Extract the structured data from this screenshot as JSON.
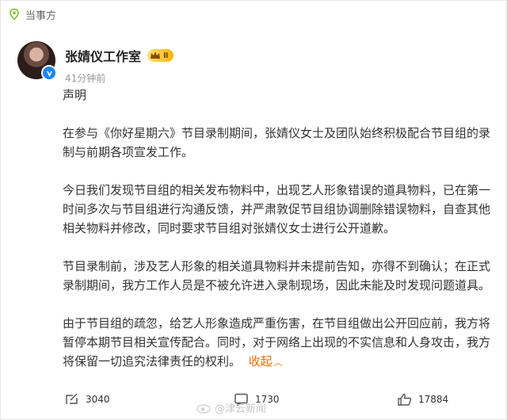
{
  "topbar": {
    "label": "当事方",
    "icon": "location-pin-icon"
  },
  "author": {
    "name": "张婧仪工作室",
    "vip_level": "Ⅱ",
    "time": "41分钟前",
    "verified": true
  },
  "post": {
    "title": "声明",
    "paragraphs": [
      "在参与《你好星期六》节目录制期间，张婧仪女士及团队始终积极配合节目组的录制与前期各项宣发工作。",
      "今日我们发现节目组的相关发布物料中，出现艺人形象错误的道具物料，已在第一时间多次与节目组进行沟通反馈，并严肃敦促节目组协调删除错误物料，自查其他相关物料并修改，同时要求节目组对张婧仪女士进行公开道歉。",
      "节目录制前，涉及艺人形象的相关道具物料并未提前告知，亦得不到确认；在正式录制期间，我方工作人员是不被允许进入录制现场，因此未能及时发现问题道具。",
      "由于节目组的疏忽，给艺人形象造成严重伤害，在节目组做出公开回应前，我方将暂停本期节目相关宣传配合。同时，对于网络上出现的不实信息和人身攻击，我方将保留一切追究法律责任的权利。"
    ],
    "collapse_label": "收起"
  },
  "actions": {
    "repost_count": "3040",
    "comment_count": "1730",
    "like_count": "17884"
  },
  "watermark": {
    "text": "@津云新闻"
  },
  "colors": {
    "accent": "#f56c00",
    "verify": "#1a84ff",
    "muted": "#999999"
  }
}
